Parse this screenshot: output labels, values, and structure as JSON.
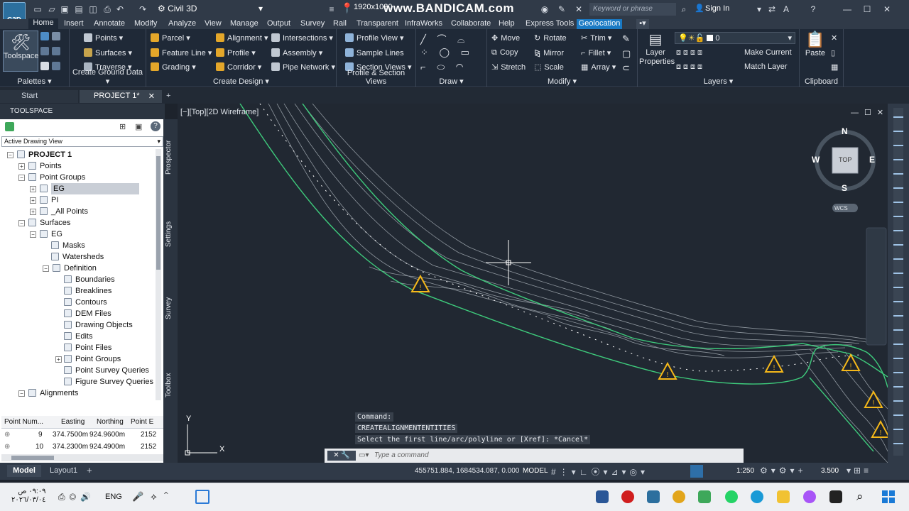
{
  "titlebar": {
    "app_badge": "C3D",
    "workspace": "Civil 3D",
    "resolution": "1920x1080",
    "watermark": "www.BANDICAM.com",
    "search_placeholder": "Keyword or phrase",
    "sign_in": "Sign In"
  },
  "ribbon_tabs": [
    "Home",
    "Insert",
    "Annotate",
    "Modify",
    "Analyze",
    "View",
    "Manage",
    "Output",
    "Survey",
    "Rail",
    "Transparent",
    "InfraWorks",
    "Collaborate",
    "Help",
    "Express Tools",
    "Geolocation"
  ],
  "ribbon": {
    "palettes": {
      "label": "Palettes",
      "toolspace": "Toolspace"
    },
    "ground": {
      "label": "Create Ground Data",
      "items": [
        "Points",
        "Surfaces",
        "Traverse"
      ]
    },
    "design": {
      "label": "Create Design",
      "items": [
        "Parcel",
        "Feature Line",
        "Grading",
        "Alignment",
        "Profile",
        "Corridor",
        "Intersections",
        "Assembly",
        "Pipe Network"
      ]
    },
    "profile": {
      "label": "Profile & Section Views",
      "items": [
        "Profile View",
        "Sample Lines",
        "Section Views"
      ]
    },
    "draw": {
      "label": "Draw"
    },
    "modify": {
      "label": "Modify",
      "items": [
        "Move",
        "Rotate",
        "Trim",
        "Copy",
        "Mirror",
        "Fillet",
        "Stretch",
        "Scale",
        "Array"
      ]
    },
    "layers": {
      "label": "Layers",
      "layer_properties": "Layer Properties",
      "current_layer": "0",
      "make_current": "Make Current",
      "match_layer": "Match Layer"
    },
    "clipboard": {
      "label": "Clipboard",
      "paste": "Paste"
    }
  },
  "doc_tabs": {
    "start": "Start",
    "project": "PROJECT 1*"
  },
  "toolspace": {
    "title": "TOOLSPACE",
    "view_select": "Active Drawing View",
    "side_tabs": [
      "Prospector",
      "Settings",
      "Survey",
      "Toolbox"
    ],
    "tree": [
      {
        "label": "PROJECT 1",
        "level": 0,
        "bold": true
      },
      {
        "label": "Points",
        "level": 1
      },
      {
        "label": "Point Groups",
        "level": 1
      },
      {
        "label": "EG",
        "level": 2,
        "selected": true
      },
      {
        "label": "PI",
        "level": 2
      },
      {
        "label": "_All Points",
        "level": 2
      },
      {
        "label": "Surfaces",
        "level": 1
      },
      {
        "label": "EG",
        "level": 2
      },
      {
        "label": "Masks",
        "level": 3
      },
      {
        "label": "Watersheds",
        "level": 3
      },
      {
        "label": "Definition",
        "level": 3
      },
      {
        "label": "Boundaries",
        "level": 4
      },
      {
        "label": "Breaklines",
        "level": 4
      },
      {
        "label": "Contours",
        "level": 4
      },
      {
        "label": "DEM Files",
        "level": 4
      },
      {
        "label": "Drawing Objects",
        "level": 4
      },
      {
        "label": "Edits",
        "level": 4
      },
      {
        "label": "Point Files",
        "level": 4
      },
      {
        "label": "Point Groups",
        "level": 4
      },
      {
        "label": "Point Survey Queries",
        "level": 4
      },
      {
        "label": "Figure Survey Queries",
        "level": 4
      },
      {
        "label": "Alignments",
        "level": 1
      }
    ],
    "table": {
      "headers": [
        "Point Num...",
        "Easting",
        "Northing",
        "Point E"
      ],
      "rows": [
        [
          "9",
          "374.7500m",
          "924.9600m",
          "2152"
        ],
        [
          "10",
          "374.2300m",
          "924.4900m",
          "2152"
        ]
      ]
    }
  },
  "viewport": {
    "label": "[−][Top][2D Wireframe]",
    "viewcube": {
      "n": "N",
      "s": "S",
      "e": "E",
      "w": "W",
      "top": "TOP",
      "wcs": "WCS"
    },
    "ucs": {
      "x": "X",
      "y": "Y"
    }
  },
  "command": {
    "history": [
      "Command:",
      "CREATEALIGNMENTENTITIES",
      "Select the first line/arc/polyline or [Xref]: *Cancel*"
    ],
    "placeholder": "Type a command"
  },
  "status": {
    "model_tab": "Model",
    "layout_tab": "Layout1",
    "coords": "455751.884, 1684534.087, 0.000",
    "space": "MODEL",
    "scale": "1:250",
    "value": "3.500"
  },
  "taskbar": {
    "time": "٠٩:٠٩ ص",
    "date": "٢٠٢٦/٠٣/٠٤",
    "lang": "ENG"
  },
  "colors": {
    "accent": "#1a7ac4",
    "surface_boundary": "#3ecb7c",
    "alignment": "#ffffff",
    "warning": "#f5b81a"
  }
}
